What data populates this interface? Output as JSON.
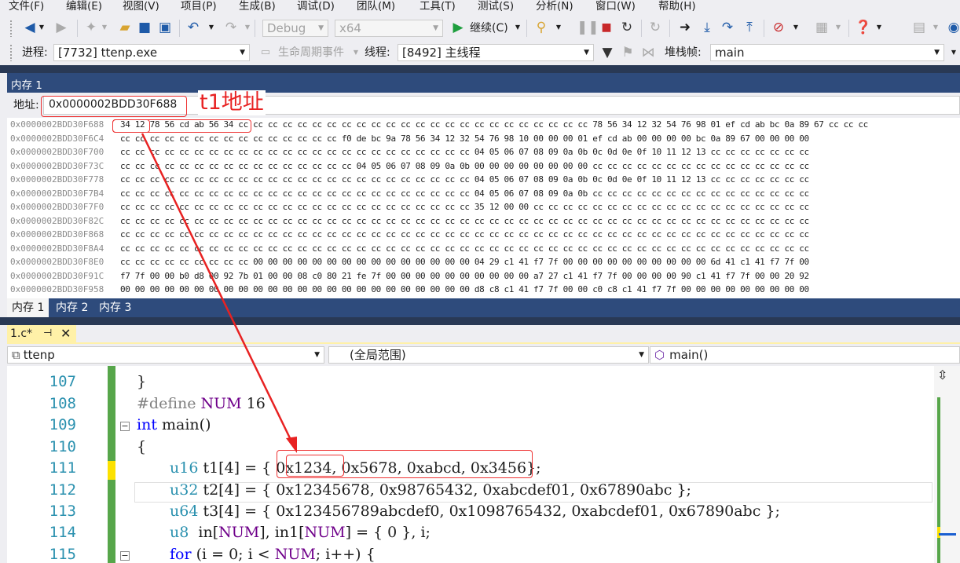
{
  "menu": [
    "文件(F)",
    "编辑(E)",
    "视图(V)",
    "项目(P)",
    "生成(B)",
    "调试(D)",
    "团队(M)",
    "工具(T)",
    "测试(S)",
    "分析(N)",
    "窗口(W)",
    "帮助(H)"
  ],
  "toolbar": {
    "config": "Debug",
    "platform": "x64",
    "continue_label": "继续(C)",
    "process_label": "进程:",
    "process_value": "[7732] ttenp.exe",
    "lifecycle_label": "生命周期事件",
    "thread_label": "线程:",
    "thread_value": "[8492] 主线程",
    "stackframe_label": "堆栈帧:",
    "stackframe_value": "main"
  },
  "memory": {
    "title": "内存 1",
    "address_label": "地址:",
    "address_value": "0x0000002BDD30F688",
    "annotation": "t1地址",
    "rows": [
      {
        "addr": "0x0000002BDD30F688",
        "bytes": "34 12 78 56 cd ab 56 34 cc cc cc cc cc cc cc cc cc cc cc cc cc cc cc cc cc cc cc cc cc cc cc cc 78 56 34 12 32 54 76 98 01 ef cd ab bc 0a 89 67 cc cc cc"
      },
      {
        "addr": "0x0000002BDD30F6C4",
        "bytes": "cc cc cc cc cc cc cc cc cc cc cc cc cc cc cc f0 de bc 9a 78 56 34 12 32 54 76 98 10 00 00 00 01 ef cd ab 00 00 00 00 bc 0a 89 67 00 00 00 00"
      },
      {
        "addr": "0x0000002BDD30F700",
        "bytes": "cc cc cc cc cc cc cc cc cc cc cc cc cc cc cc cc cc cc cc cc cc cc cc cc 04 05 06 07 08 09 0a 0b 0c 0d 0e 0f 10 11 12 13 cc cc cc cc cc cc cc"
      },
      {
        "addr": "0x0000002BDD30F73C",
        "bytes": "cc cc cc cc cc cc cc cc cc cc cc cc cc cc cc cc 04 05 06 07 08 09 0a 0b 00 00 00 00 00 00 00 00 cc cc cc cc cc cc cc cc cc cc cc cc cc cc cc"
      },
      {
        "addr": "0x0000002BDD30F778",
        "bytes": "cc cc cc cc cc cc cc cc cc cc cc cc cc cc cc cc cc cc cc cc cc cc cc cc 04 05 06 07 08 09 0a 0b 0c 0d 0e 0f 10 11 12 13 cc cc cc cc cc cc cc"
      },
      {
        "addr": "0x0000002BDD30F7B4",
        "bytes": "cc cc cc cc cc cc cc cc cc cc cc cc cc cc cc cc cc cc cc cc cc cc cc cc 04 05 06 07 08 09 0a 0b cc cc cc cc cc cc cc cc cc cc cc cc cc cc cc"
      },
      {
        "addr": "0x0000002BDD30F7F0",
        "bytes": "cc cc cc cc cc cc cc cc cc cc cc cc cc cc cc cc cc cc cc cc cc cc cc cc 35 12 00 00 cc cc cc cc cc cc cc cc cc cc cc cc cc cc cc cc cc cc cc"
      },
      {
        "addr": "0x0000002BDD30F82C",
        "bytes": "cc cc cc cc cc cc cc cc cc cc cc cc cc cc cc cc cc cc cc cc cc cc cc cc cc cc cc cc cc cc cc cc cc cc cc cc cc cc cc cc cc cc cc cc cc cc cc"
      },
      {
        "addr": "0x0000002BDD30F868",
        "bytes": "cc cc cc cc cc cc cc cc cc cc cc cc cc cc cc cc cc cc cc cc cc cc cc cc cc cc cc cc cc cc cc cc cc cc cc cc cc cc cc cc cc cc cc cc cc cc cc"
      },
      {
        "addr": "0x0000002BDD30F8A4",
        "bytes": "cc cc cc cc cc cc cc cc cc cc cc cc cc cc cc cc cc cc cc cc cc cc cc cc cc cc cc cc cc cc cc cc cc cc cc cc cc cc cc cc cc cc cc cc cc cc cc"
      },
      {
        "addr": "0x0000002BDD30F8E0",
        "bytes": "cc cc cc cc cc cc cc cc cc 00 00 00 00 00 00 00 00 00 00 00 00 00 00 00 04 29 c1 41 f7 7f 00 00 00 00 00 00 00 00 00 00 6d 41 c1 41 f7 7f 00"
      },
      {
        "addr": "0x0000002BDD30F91C",
        "bytes": "f7 7f 00 00 b0 d8 00 92 7b 01 00 00 08 c0 80 21 fe 7f 00 00 00 00 00 00 00 00 00 00 a7 27 c1 41 f7 7f 00 00 00 00 90 c1 41 f7 7f 00 00 20 92"
      },
      {
        "addr": "0x0000002BDD30F958",
        "bytes": "00 00 00 00 00 00 00 00 00 00 00 00 00 00 00 00 00 00 00 00 00 00 00 00 d8 c8 c1 41 f7 7f 00 00 c0 c8 c1 41 f7 7f 00 00 00 00 00 00 00 00 00"
      }
    ],
    "tabs": [
      "内存 1",
      "内存 2",
      "内存 3"
    ]
  },
  "editor": {
    "file_tab": "1.c*",
    "nav_project": "ttenp",
    "nav_scope": "(全局范围)",
    "nav_member": "main()",
    "lines": [
      {
        "no": "107",
        "text": "}"
      },
      {
        "no": "108",
        "text": "#define NUM 16"
      },
      {
        "no": "109",
        "text": "int main()"
      },
      {
        "no": "110",
        "text": "{"
      },
      {
        "no": "111",
        "text": "u16 t1[4] = { 0x1234, 0x5678, 0xabcd, 0x3456};"
      },
      {
        "no": "112",
        "text": "u32 t2[4] = { 0x12345678, 0x98765432, 0xabcdef01, 0x67890abc };"
      },
      {
        "no": "113",
        "text": "u64 t3[4] = { 0x123456789abcdef0, 0x1098765432, 0xabcdef01, 0x67890abc };"
      },
      {
        "no": "114",
        "text": "u8  in[NUM], in1[NUM] = { 0 }, i;"
      },
      {
        "no": "115",
        "text": "for (i = 0; i < NUM; i++) {"
      }
    ]
  }
}
